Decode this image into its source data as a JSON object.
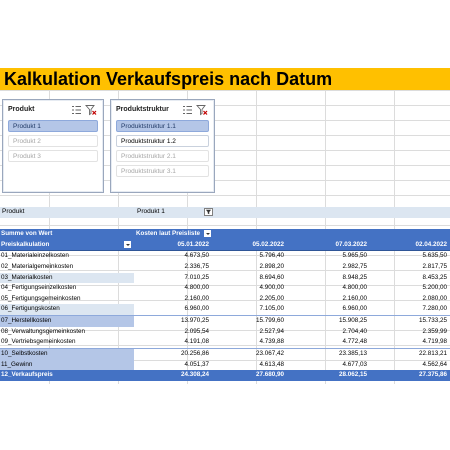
{
  "title": "Kalkulation Verkaufspreis nach Datum",
  "slicers": {
    "produkt": {
      "header": "Produkt",
      "items": [
        {
          "label": "Produkt 1",
          "state": "selected"
        },
        {
          "label": "Produkt 2",
          "state": "dim"
        },
        {
          "label": "Produkt 3",
          "state": "dim"
        }
      ]
    },
    "produktstruktur": {
      "header": "Produktstruktur",
      "items": [
        {
          "label": "Produktstruktur 1.1",
          "state": "selected"
        },
        {
          "label": "Produktstruktur 1.2",
          "state": "avail"
        },
        {
          "label": "Produktstruktur 2.1",
          "state": "dim"
        },
        {
          "label": "Produktstruktur 3.1",
          "state": "dim"
        }
      ]
    }
  },
  "filter": {
    "field": "Produkt",
    "value": "Produkt 1"
  },
  "pivot": {
    "values_label": "Summe von Wert",
    "column_field": "Kosten laut Preisliste",
    "row_field": "Preiskalkulation",
    "dates": [
      "05.01.2022",
      "05.02.2022",
      "07.03.2022",
      "02.04.2022"
    ],
    "rows": [
      {
        "label": "01_Materialeinzelkosten",
        "values": [
          "4.673,50",
          "5.796,40",
          "5.965,50",
          "5.635,50"
        ],
        "style": "normal"
      },
      {
        "label": "02_Materialgemeinkosten",
        "values": [
          "2.336,75",
          "2.898,20",
          "2.982,75",
          "2.817,75"
        ],
        "style": "normal"
      },
      {
        "label": "03_Materialkosten",
        "values": [
          "7.010,25",
          "8.694,60",
          "8.948,25",
          "8.453,25"
        ],
        "style": "light"
      },
      {
        "label": "04_Fertigungseinzelkosten",
        "values": [
          "4.800,00",
          "4.900,00",
          "4.800,00",
          "5.200,00"
        ],
        "style": "normal"
      },
      {
        "label": "05_Fertigungsgemeinkosten",
        "values": [
          "2.160,00",
          "2.205,00",
          "2.160,00",
          "2.080,00"
        ],
        "style": "normal"
      },
      {
        "label": "06_Fertigungskosten",
        "values": [
          "6.960,00",
          "7.105,00",
          "6.960,00",
          "7.280,00"
        ],
        "style": "light"
      },
      {
        "label": "07_Herstellkosten",
        "values": [
          "13.970,25",
          "15.799,60",
          "15.908,25",
          "15.733,25"
        ],
        "style": "mid"
      },
      {
        "label": "08_Verwaltungsgemeinkosten",
        "values": [
          "2.095,54",
          "2.527,94",
          "2.704,40",
          "2.359,99"
        ],
        "style": "normal"
      },
      {
        "label": "09_Vertriebsgemeinkosten",
        "values": [
          "4.191,08",
          "4.739,88",
          "4.772,48",
          "4.719,98"
        ],
        "style": "normal"
      },
      {
        "label": "10_Selbstkosten",
        "values": [
          "20.256,86",
          "23.067,42",
          "23.385,13",
          "22.813,21"
        ],
        "style": "mid"
      },
      {
        "label": "11_Gewinn",
        "values": [
          "4.051,37",
          "4.613,48",
          "4.677,03",
          "4.562,64"
        ],
        "style": "mid"
      },
      {
        "label": "12_Verkaufspreis",
        "values": [
          "24.308,24",
          "27.680,90",
          "28.062,15",
          "27.375,86"
        ],
        "style": "total"
      }
    ]
  }
}
